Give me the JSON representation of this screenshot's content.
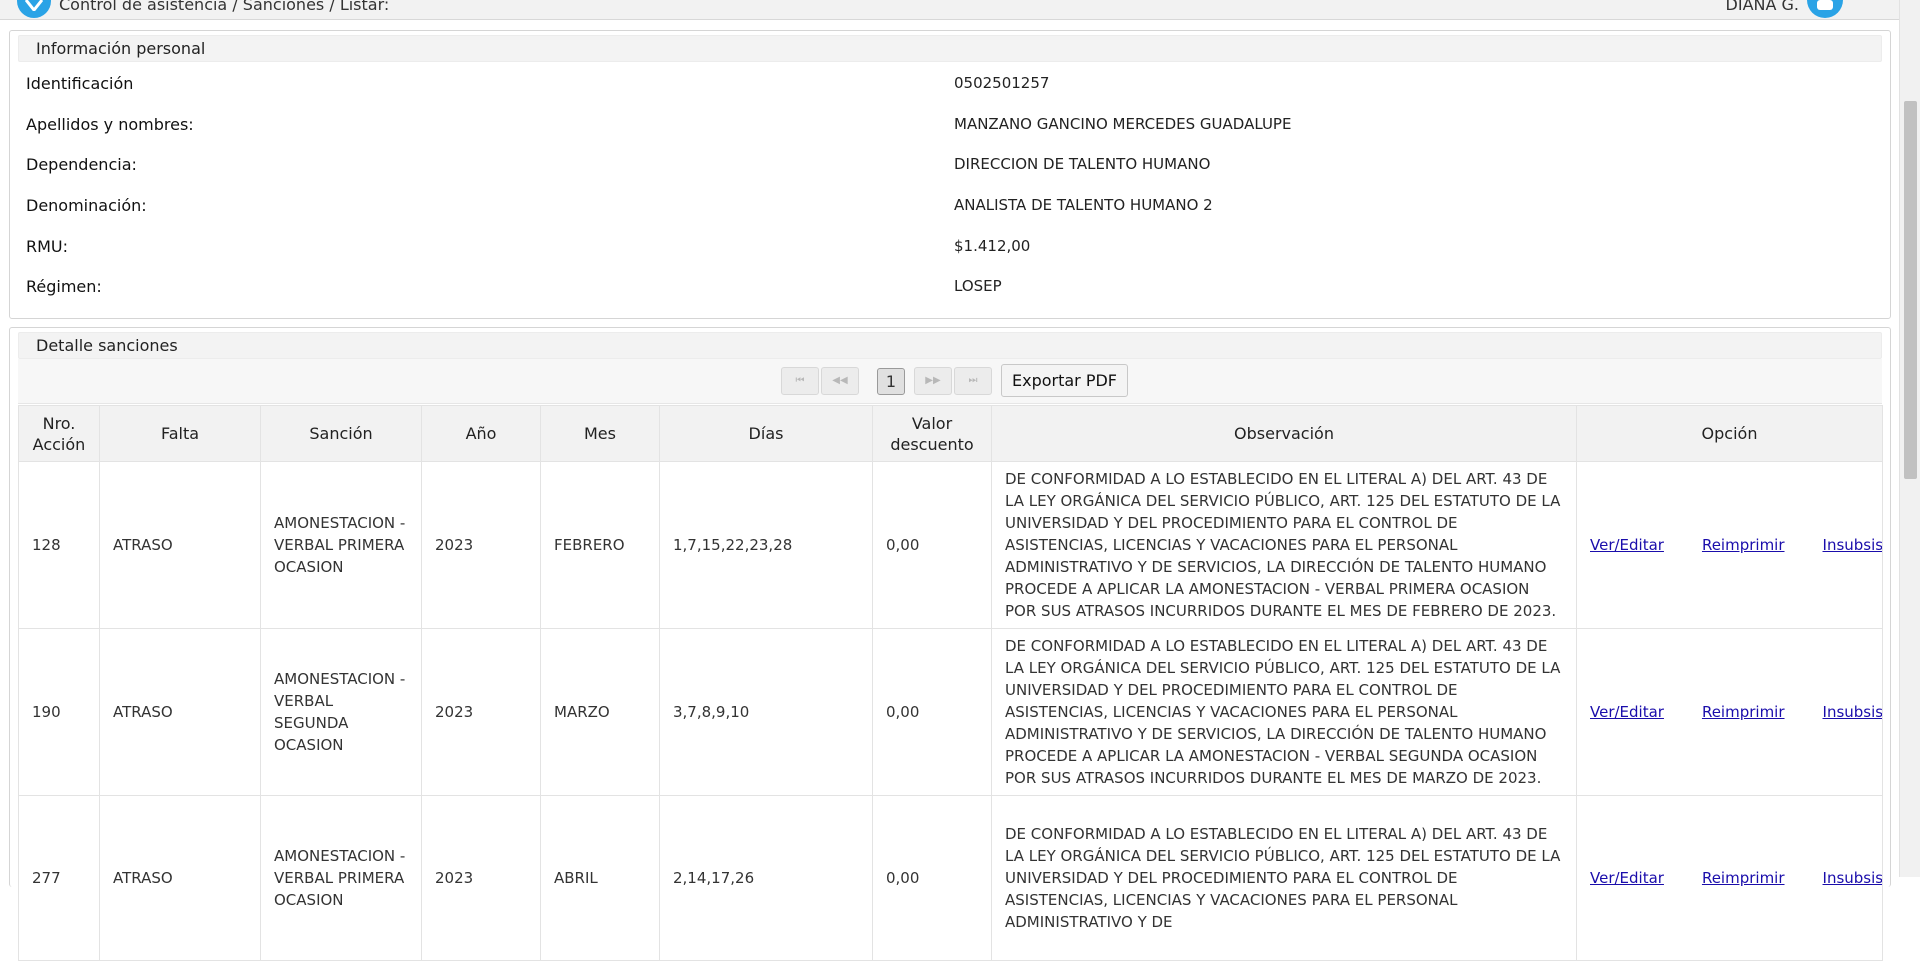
{
  "header": {
    "breadcrumb": "Control de asistencia / Sanciones / Listar:",
    "user_name": "DIANA G."
  },
  "personal": {
    "title": "Información personal",
    "rows": [
      {
        "label": "Identificación",
        "value": "0502501257"
      },
      {
        "label": "Apellidos y nombres:",
        "value": "MANZANO GANCINO MERCEDES GUADALUPE"
      },
      {
        "label": "Dependencia:",
        "value": "DIRECCION DE TALENTO HUMANO"
      },
      {
        "label": "Denominación:",
        "value": "ANALISTA DE TALENTO HUMANO 2"
      },
      {
        "label": "RMU:",
        "value": "$1.412,00"
      },
      {
        "label": "Régimen:",
        "value": "LOSEP"
      }
    ]
  },
  "sanciones": {
    "title": "Detalle sanciones",
    "pager": {
      "first": "⏮",
      "prev": "◀◀",
      "current_page": "1",
      "next": "▶▶",
      "last": "⏭",
      "export_label": "Exportar PDF"
    },
    "columns": [
      "Nro. Acción",
      "Falta",
      "Sanción",
      "Año",
      "Mes",
      "Días",
      "Valor descuento",
      "Observación",
      "Opción"
    ],
    "rows": [
      {
        "nro": "128",
        "falta": "ATRASO",
        "sancion": "AMONESTACION - VERBAL PRIMERA OCASION",
        "anio": "2023",
        "mes": "FEBRERO",
        "dias": "1,7,15,22,23,28",
        "valor": "0,00",
        "observacion": "DE CONFORMIDAD A LO ESTABLECIDO EN EL LITERAL A) DEL ART. 43 DE LA LEY ORGÁNICA DEL SERVICIO PÚBLICO, ART. 125 DEL ESTATUTO DE LA UNIVERSIDAD Y DEL PROCEDIMIENTO PARA EL CONTROL DE ASISTENCIAS, LICENCIAS Y VACACIONES PARA EL PERSONAL ADMINISTRATIVO Y DE SERVICIOS, LA DIRECCIÓN DE TALENTO HUMANO PROCEDE A APLICAR LA AMONESTACION - VERBAL PRIMERA OCASION POR SUS ATRASOS INCURRIDOS DURANTE EL MES DE FEBRERO DE 2023.",
        "ver": "Ver/Editar",
        "reimprimir": "Reimprimir",
        "insub": "Insubsistente"
      },
      {
        "nro": "190",
        "falta": "ATRASO",
        "sancion": "AMONESTACION - VERBAL SEGUNDA OCASION",
        "anio": "2023",
        "mes": "MARZO",
        "dias": "3,7,8,9,10",
        "valor": "0,00",
        "observacion": "DE CONFORMIDAD A LO ESTABLECIDO EN EL LITERAL A) DEL ART. 43 DE LA LEY ORGÁNICA DEL SERVICIO PÚBLICO, ART. 125 DEL ESTATUTO DE LA UNIVERSIDAD Y DEL PROCEDIMIENTO PARA EL CONTROL DE ASISTENCIAS, LICENCIAS Y VACACIONES PARA EL PERSONAL ADMINISTRATIVO Y DE SERVICIOS, LA DIRECCIÓN DE TALENTO HUMANO PROCEDE A APLICAR LA AMONESTACION - VERBAL SEGUNDA OCASION POR SUS ATRASOS INCURRIDOS DURANTE EL MES DE MARZO DE 2023.",
        "ver": "Ver/Editar",
        "reimprimir": "Reimprimir",
        "insub": "Insubsistente"
      },
      {
        "nro": "277",
        "falta": "ATRASO",
        "sancion": "AMONESTACION - VERBAL PRIMERA OCASION",
        "anio": "2023",
        "mes": "ABRIL",
        "dias": "2,14,17,26",
        "valor": "0,00",
        "observacion": "DE CONFORMIDAD A LO ESTABLECIDO EN EL LITERAL A) DEL ART. 43 DE LA LEY ORGÁNICA DEL SERVICIO PÚBLICO, ART. 125 DEL ESTATUTO DE LA UNIVERSIDAD Y DEL PROCEDIMIENTO PARA EL CONTROL DE ASISTENCIAS, LICENCIAS Y VACACIONES PARA EL PERSONAL ADMINISTRATIVO Y DE",
        "ver": "Ver/Editar",
        "reimprimir": "Reimprimir",
        "insub": "Insubsistente"
      }
    ]
  }
}
